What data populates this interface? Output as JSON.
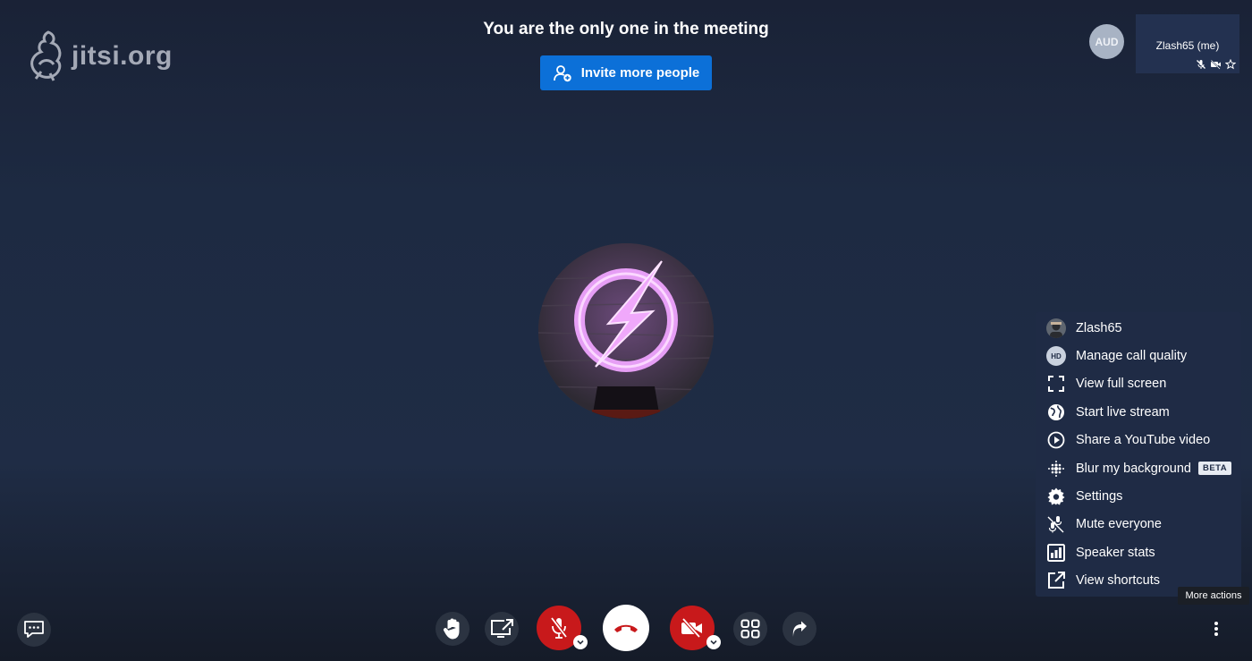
{
  "logo": {
    "text": "jitsi.org"
  },
  "notice": {
    "title": "You are the only one in the meeting",
    "invite_label": "Invite more people"
  },
  "participants": {
    "avatar_initials": "AUD",
    "self_name": "Zlash65 (me)"
  },
  "menu": {
    "items": [
      {
        "label": "Zlash65",
        "icon": "user-avatar"
      },
      {
        "label": "Manage call quality",
        "icon": "hd-icon",
        "icon_text": "HD"
      },
      {
        "label": "View full screen",
        "icon": "fullscreen-icon"
      },
      {
        "label": "Start live stream",
        "icon": "globe-icon"
      },
      {
        "label": "Share a YouTube video",
        "icon": "play-circle-icon"
      },
      {
        "label": "Blur my background",
        "icon": "blur-icon",
        "badge": "BETA"
      },
      {
        "label": "Settings",
        "icon": "gear-icon"
      },
      {
        "label": "Mute everyone",
        "icon": "mute-all-icon"
      },
      {
        "label": "Speaker stats",
        "icon": "stats-icon"
      },
      {
        "label": "View shortcuts",
        "icon": "external-link-icon"
      }
    ]
  },
  "tooltip": {
    "text": "More actions"
  },
  "colors": {
    "accent": "#0c70d8",
    "danger": "#c8191b",
    "menu_bg": "#1f2b45"
  }
}
